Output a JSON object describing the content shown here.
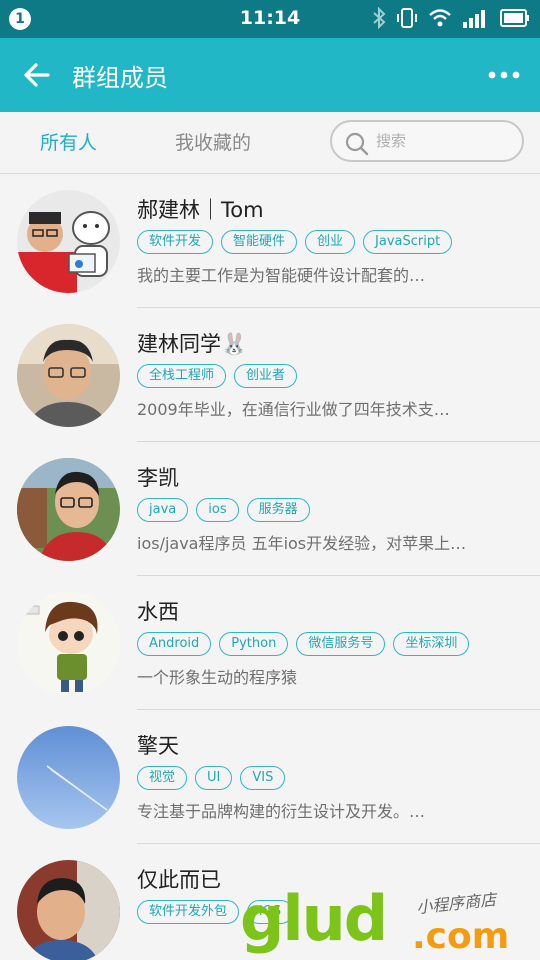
{
  "status_bar": {
    "notification_count": "1",
    "time": "11:14",
    "icons": [
      "bluetooth-icon",
      "vibrate-icon",
      "wifi-icon",
      "signal-icon",
      "battery-icon"
    ]
  },
  "app_bar": {
    "title": "群组成员",
    "back_icon": "arrow-left-icon",
    "more_icon": "more-dots-icon"
  },
  "tabs": [
    {
      "label": "所有人",
      "active": true
    },
    {
      "label": "我收藏的",
      "active": false
    }
  ],
  "search": {
    "placeholder": "搜索"
  },
  "members": [
    {
      "name": "郝建林｜Tom",
      "tags": [
        "软件开发",
        "智能硬件",
        "创业",
        "JavaScript"
      ],
      "desc": "我的主要工作是为智能硬件设计配套的…"
    },
    {
      "name": "建林同学🐰",
      "tags": [
        "全栈工程师",
        "创业者"
      ],
      "desc": "2009年毕业，在通信行业做了四年技术支…"
    },
    {
      "name": "李凯",
      "tags": [
        "java",
        "ios",
        "服务器"
      ],
      "desc": "ios/java程序员 五年ios开发经验，对苹果上…"
    },
    {
      "name": "水西",
      "tags": [
        "Android",
        "Python",
        "微信服务号",
        "坐标深圳"
      ],
      "desc": "一个形象生动的程序猿"
    },
    {
      "name": "擎天",
      "tags": [
        "视觉",
        "UI",
        "VIS"
      ],
      "desc": "专注基于品牌构建的衍生设计及开发。…"
    },
    {
      "name": "仅此而已",
      "tags": [
        "软件开发外包",
        "iOS"
      ],
      "desc": ""
    }
  ],
  "watermark": {
    "brand": "glud",
    "suffix": ".com",
    "caption": "小程序商店"
  },
  "colors": {
    "status_bar": "#0d7a86",
    "app_bar": "#21b7c6",
    "accent": "#1fb1bf",
    "background": "#f4f4f4"
  }
}
